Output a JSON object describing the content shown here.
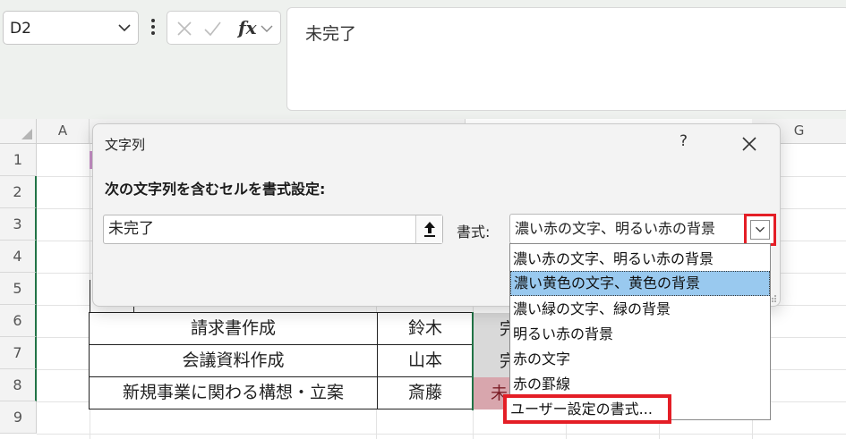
{
  "formula_bar": {
    "name_box": "D2",
    "formula": "未完了",
    "fx_label": "fx",
    "icons": [
      "chevron-down-icon",
      "more-vertical-icon",
      "cancel-x-icon",
      "confirm-check-icon",
      "function-fx-icon"
    ]
  },
  "grid": {
    "columns": [
      "A",
      "G"
    ],
    "rows": [
      "1",
      "2",
      "3",
      "4",
      "5",
      "6",
      "7",
      "8",
      "9"
    ],
    "table_rows": [
      {
        "task": "請求書作成",
        "person": "鈴木",
        "status_partial": "完"
      },
      {
        "task": "会議資料作成",
        "person": "山本",
        "status_partial": "完"
      },
      {
        "task": "新規事業に関わる構想・立案",
        "person": "斎藤",
        "status_partial": "未"
      }
    ]
  },
  "dialog": {
    "title": "文字列",
    "help": "?",
    "instruction": "次の文字列を含むセルを書式設定:",
    "input_value": "未完了",
    "format_label": "書式:",
    "format_selected": "濃い赤の文字、明るい赤の背景",
    "options": [
      "濃い赤の文字、明るい赤の背景",
      "濃い黄色の文字、黄色の背景",
      "濃い緑の文字、緑の背景",
      "明るい赤の背景",
      "赤の文字",
      "赤の罫線",
      "ユーザー設定の書式..."
    ],
    "highlighted_option_index": 1,
    "highlight_color": "#99c9ef",
    "callout_color": "#e41e26"
  }
}
